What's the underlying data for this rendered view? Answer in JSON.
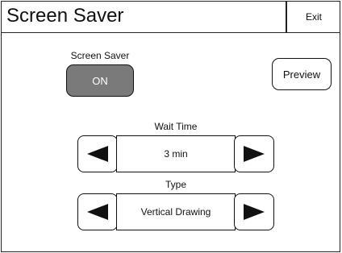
{
  "header": {
    "title": "Screen Saver",
    "exit_label": "Exit"
  },
  "screen_saver": {
    "label": "Screen Saver",
    "toggle_value": "ON"
  },
  "preview": {
    "label": "Preview"
  },
  "wait_time": {
    "label": "Wait Time",
    "value": "3 min"
  },
  "type": {
    "label": "Type",
    "value": "Vertical Drawing"
  },
  "icons": {
    "decrement": "left-arrow-icon",
    "increment": "right-arrow-icon"
  },
  "colors": {
    "toggle_on_bg": "#7a7a7a",
    "border": "#111111"
  }
}
